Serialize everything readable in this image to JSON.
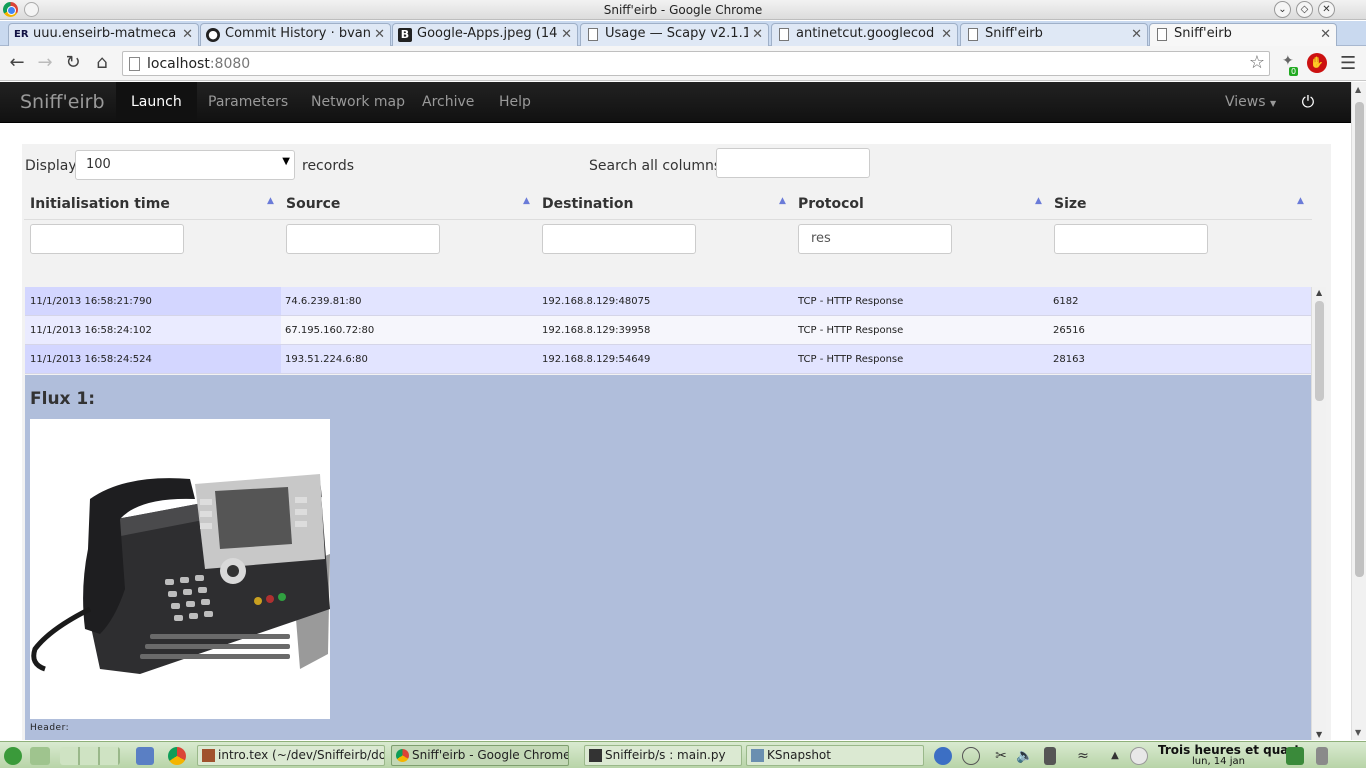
{
  "window": {
    "title": "Sniff'eirb - Google Chrome"
  },
  "tabs": [
    {
      "label": "uuu.enseirb-matmeca",
      "icon": "enseirb-icon"
    },
    {
      "label": "Commit History · bvanc",
      "icon": "github-icon"
    },
    {
      "label": "Google-Apps.jpeg (14",
      "icon": "blogger-icon"
    },
    {
      "label": "Usage — Scapy v2.1.1",
      "icon": "document-icon"
    },
    {
      "label": "antinetcut.googlecod",
      "icon": "document-icon"
    },
    {
      "label": "Sniff'eirb",
      "icon": "document-icon"
    },
    {
      "label": "Sniff'eirb",
      "icon": "document-icon"
    }
  ],
  "omnibox": {
    "host": "localhost",
    "port": ":8080"
  },
  "extensions": {
    "badge": "0"
  },
  "navbar": {
    "brand": "Sniff'eirb",
    "items": [
      "Launch",
      "Parameters",
      "Network map",
      "Archive",
      "Help"
    ],
    "views": "Views"
  },
  "table": {
    "length_label": "Display",
    "length_value": "100",
    "length_suffix": "records",
    "search_label": "Search all columns:",
    "columns": [
      "Initialisation time",
      "Source",
      "Destination",
      "Protocol",
      "Size"
    ],
    "column_filters": [
      "",
      "",
      "",
      "res",
      ""
    ],
    "rows": [
      [
        "11/1/2013 16:58:21:790",
        "74.6.239.81:80",
        "192.168.8.129:48075",
        "TCP - HTTP Response",
        "6182"
      ],
      [
        "11/1/2013 16:58:24:102",
        "67.195.160.72:80",
        "192.168.8.129:39958",
        "TCP - HTTP Response",
        "26516"
      ],
      [
        "11/1/2013 16:58:24:524",
        "193.51.224.6:80",
        "192.168.8.129:54649",
        "TCP - HTTP Response",
        "28163"
      ]
    ]
  },
  "detail": {
    "title": "Flux 1:",
    "header_label": "Header:"
  },
  "taskbar": {
    "tasks": [
      {
        "label": "intro.tex (~/dev/Sniffeirb/doc",
        "icon": "text-editor-icon"
      },
      {
        "label": "Sniff'eirb - Google Chrome",
        "icon": "chrome-icon"
      },
      {
        "label": "Sniffeirb/s : main.py",
        "icon": "terminal-icon"
      },
      {
        "label": "KSnapshot",
        "icon": "camera-icon"
      }
    ],
    "clock_line1": "Trois heures et quart",
    "clock_line2": "lun, 14 jan"
  }
}
